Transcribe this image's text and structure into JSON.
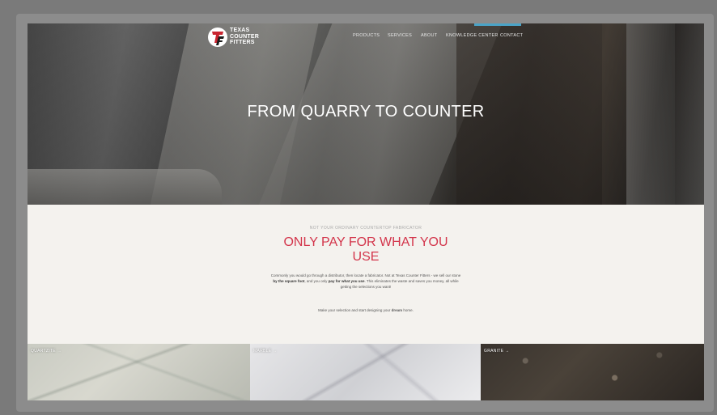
{
  "logo": {
    "line1": "TEXAS",
    "line2": "COUNTER",
    "line3": "FITTERS"
  },
  "nav": {
    "items": [
      {
        "label": "PRODUCTS"
      },
      {
        "label": "SERVICES"
      },
      {
        "label": "ABOUT"
      },
      {
        "label": "KNOWLEDGE CENTER"
      },
      {
        "label": "CONTACT"
      }
    ],
    "active": "CONTACT",
    "active_color": "#4aa3c7"
  },
  "hero": {
    "title": "FROM QUARRY TO COUNTER"
  },
  "section": {
    "eyebrow": "NOT YOUR ORDINARY COUNTERTOP FABRICATOR",
    "headline": "ONLY PAY FOR WHAT YOU USE",
    "headline_color": "#d3354b",
    "body_1": "Commonly you would go through a distributor, then locate a fabricator. Not at Texas Counter Fitters - we sell our stone ",
    "body_b1": "by the square foot",
    "body_2": ", and you only ",
    "body_b2": "pay for what you use",
    "body_3": ". This eliminates the waste and saves you money, all while getting the selections you want!",
    "tagline_1": "Make your selection and start designing your ",
    "tagline_b": "dream",
    "tagline_2": " home."
  },
  "tiles": [
    {
      "label": "QUARTZITE →"
    },
    {
      "label": "MARBLE →"
    },
    {
      "label": "GRANITE →"
    }
  ]
}
